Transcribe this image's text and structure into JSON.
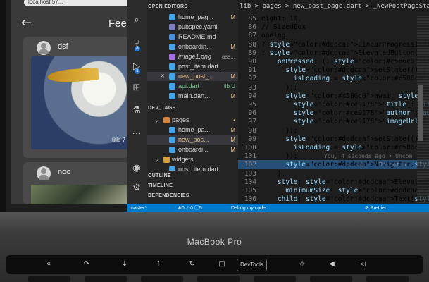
{
  "phone": {
    "url": "localhost:57...",
    "title": "Feed",
    "back_icon": "arrow-left-icon",
    "posts": [
      {
        "user": "dsf",
        "title": "title 7"
      },
      {
        "user": "noo"
      }
    ]
  },
  "activity_bar": {
    "icons": [
      "search-icon",
      "source-control-icon",
      "run-debug-icon",
      "extensions-icon",
      "testing-icon",
      "more-icon",
      "account-icon",
      "settings-icon"
    ],
    "badges": {
      "source_control": "8",
      "run_debug": "1"
    }
  },
  "explorer": {
    "open_editors_label": "OPEN EDITORS",
    "open_editors": [
      {
        "name": "home_pag...",
        "status": "M"
      },
      {
        "name": "pubspec.yaml",
        "status": ""
      },
      {
        "name": "README.md",
        "status": ""
      },
      {
        "name": "onboardin...",
        "status": "M"
      },
      {
        "name": "image1.png",
        "status": "ass..."
      },
      {
        "name": "post_item.dart...",
        "status": ""
      },
      {
        "name": "new_post_...",
        "status": "M"
      },
      {
        "name": "api.dart",
        "status": "lib U"
      },
      {
        "name": "main.dart...",
        "status": "M"
      }
    ],
    "project_label": "DEV_TAGS",
    "tree": [
      {
        "name": "pages",
        "status": "•"
      },
      {
        "name": "home_pa...",
        "status": "M"
      },
      {
        "name": "new_pos...",
        "status": "M"
      },
      {
        "name": "onboardi...",
        "status": "M"
      },
      {
        "name": "widgets",
        "status": ""
      },
      {
        "name": "post_item.dart",
        "status": ""
      }
    ],
    "outline_label": "OUTLINE",
    "timeline_label": "TIMELINE",
    "dependencies_label": "DEPENDENCIES"
  },
  "editor": {
    "breadcrumb": "lib > pages > new_post_page.dart > _NewPostPageState >",
    "lines": [
      {
        "n": "85",
        "t": "eight: 10,"
      },
      {
        "n": "86",
        "t": "// SizedBox"
      },
      {
        "n": "87",
        "t": "oading"
      },
      {
        "n": "88",
        "t": "? LinearProgressIndicator()"
      },
      {
        "n": "89",
        "t": ": ElevatedButton("
      },
      {
        "n": "90",
        "t": "    onPressed: () async {"
      },
      {
        "n": "91",
        "t": "      setState(() {"
      },
      {
        "n": "92",
        "t": "        isLoading = true;"
      },
      {
        "n": "93",
        "t": "      });"
      },
      {
        "n": "94",
        "t": "      await Dio().post(baseUrl, data: {"
      },
      {
        "n": "95",
        "t": "        \"title\": title,"
      },
      {
        "n": "96",
        "t": "        \"author\": author,"
      },
      {
        "n": "97",
        "t": "        \"imageUrl\": imageUrl,"
      },
      {
        "n": "98",
        "t": "      });"
      },
      {
        "n": "99",
        "t": "      setState(() {"
      },
      {
        "n": "100",
        "t": "        isLoading = false;"
      },
      {
        "n": "101",
        "t": "      });"
      },
      {
        "n": "102",
        "t": "      Navigator.pop(context);"
      },
      {
        "n": "103",
        "t": "    },"
      },
      {
        "n": "104",
        "t": "    style: ElevatedButton.styleFrom("
      },
      {
        "n": "105",
        "t": "      minimumSize: Size(double.infinity"
      },
      {
        "n": "106",
        "t": "    child: Text(\"Post\"),"
      }
    ],
    "git_blame": "You, 4 seconds ago • Uncom",
    "not_used": "Do not u"
  },
  "status_bar": {
    "branch": "master*",
    "problems": "⊗0 ⚠0 ⓘ5",
    "debug": "Debug my code",
    "prettier": "⊘ Prettier"
  },
  "laptop": {
    "brand": "MacBook Pro",
    "touchbar_chip": "DevTools"
  },
  "colors": {
    "statusbar": "#007acc",
    "keyword": "#c586c0",
    "function": "#dcdcaa",
    "string": "#ce9178",
    "variable": "#9cdcfe",
    "modified": "#e2c08d",
    "untracked": "#73c991"
  }
}
